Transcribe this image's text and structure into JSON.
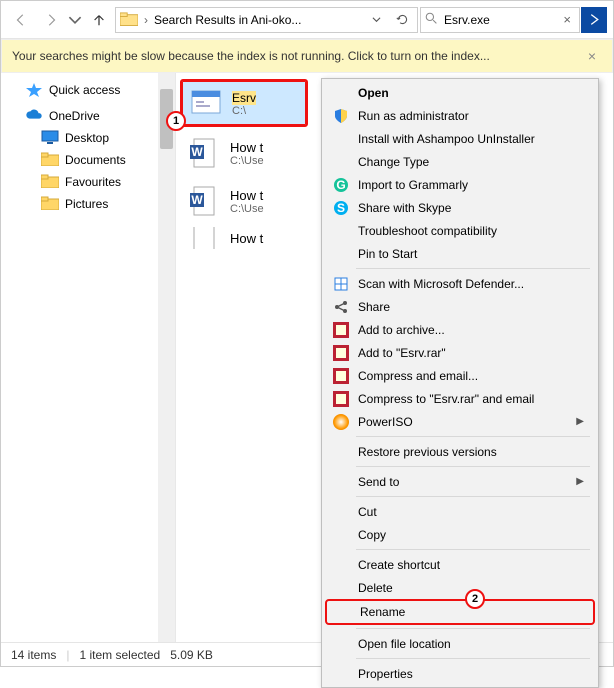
{
  "toolbar": {
    "nav": {
      "back": "back",
      "forward": "forward",
      "up": "up"
    },
    "address": {
      "chevron": "›",
      "text": "Search Results in Ani-oko..."
    },
    "search": {
      "value": "Esrv.exe"
    }
  },
  "notice": {
    "text": "Your searches might be slow because the index is not running.  Click to turn on the index..."
  },
  "sidebar": {
    "quick_access": "Quick access",
    "onedrive": "OneDrive",
    "items": [
      {
        "label": "Desktop"
      },
      {
        "label": "Documents"
      },
      {
        "label": "Favourites"
      },
      {
        "label": "Pictures"
      }
    ]
  },
  "results": [
    {
      "name_hl": "Esrv",
      "path": "C:\\"
    },
    {
      "name_plain": "How t",
      "path": "C:\\Use"
    },
    {
      "name_plain": "How t",
      "path": "C:\\Use"
    },
    {
      "name_plain": "How t",
      "path": ""
    }
  ],
  "status": {
    "count": "14 items",
    "selected": "1 item selected",
    "size": "5.09 KB"
  },
  "callouts": {
    "c1": "1",
    "c2": "2"
  },
  "context_menu": {
    "items": [
      {
        "label": "Open",
        "icon": "",
        "bold": true
      },
      {
        "label": "Run as administrator",
        "icon": "shield"
      },
      {
        "label": "Install with Ashampoo UnInstaller",
        "icon": ""
      },
      {
        "label": "Change Type",
        "icon": ""
      },
      {
        "label": "Import to Grammarly",
        "icon": "grammarly"
      },
      {
        "label": "Share with Skype",
        "icon": "skype"
      },
      {
        "label": "Troubleshoot compatibility",
        "icon": ""
      },
      {
        "label": "Pin to Start",
        "icon": ""
      },
      {
        "sep": true
      },
      {
        "label": "Scan with Microsoft Defender...",
        "icon": "defender"
      },
      {
        "label": "Share",
        "icon": "share"
      },
      {
        "label": "Add to archive...",
        "icon": "rar"
      },
      {
        "label": "Add to \"Esrv.rar\"",
        "icon": "rar"
      },
      {
        "label": "Compress and email...",
        "icon": "rar"
      },
      {
        "label": "Compress to \"Esrv.rar\" and email",
        "icon": "rar"
      },
      {
        "label": "PowerISO",
        "icon": "poweriso",
        "arrow": true
      },
      {
        "sep": true
      },
      {
        "label": "Restore previous versions",
        "icon": ""
      },
      {
        "sep": true
      },
      {
        "label": "Send to",
        "icon": "",
        "arrow": true
      },
      {
        "sep": true
      },
      {
        "label": "Cut",
        "icon": ""
      },
      {
        "label": "Copy",
        "icon": ""
      },
      {
        "sep": true
      },
      {
        "label": "Create shortcut",
        "icon": ""
      },
      {
        "label": "Delete",
        "icon": ""
      },
      {
        "label": "Rename",
        "icon": "",
        "highlight": true
      },
      {
        "sep": true
      },
      {
        "label": "Open file location",
        "icon": ""
      },
      {
        "sep": true
      },
      {
        "label": "Properties",
        "icon": ""
      }
    ]
  }
}
